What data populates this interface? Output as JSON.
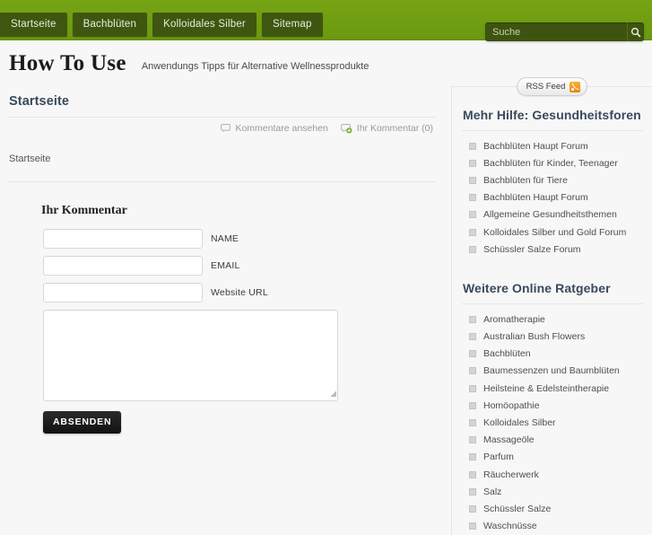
{
  "nav": {
    "items": [
      {
        "label": "Startseite"
      },
      {
        "label": "Bachblüten"
      },
      {
        "label": "Kolloidales Silber"
      },
      {
        "label": "Sitemap"
      }
    ]
  },
  "search": {
    "placeholder": "Suche",
    "value": "",
    "icon": "search-icon"
  },
  "masthead": {
    "title": "How To Use",
    "tagline": "Anwendungs Tipps für Alternative Wellnessprodukte"
  },
  "post": {
    "title": "Startseite",
    "body": "Startseite",
    "meta": {
      "view_comments": "Kommentare ansehen",
      "add_comment": "Ihr Kommentar (0)"
    }
  },
  "comment_form": {
    "heading": "Ihr Kommentar",
    "fields": [
      {
        "label": "NAME",
        "value": "",
        "placeholder": ""
      },
      {
        "label": "EMAIL",
        "value": "",
        "placeholder": ""
      },
      {
        "label": "Website URL",
        "value": "",
        "placeholder": ""
      }
    ],
    "textarea": {
      "value": "",
      "placeholder": ""
    },
    "submit_label": "ABSENDEN"
  },
  "sidebar": {
    "rss": {
      "label": "RSS Feed",
      "icon": "rss-icon"
    },
    "widgets": [
      {
        "title": "Mehr Hilfe: Gesundheitsforen",
        "items": [
          "Bachblüten Haupt Forum",
          "Bachblüten für Kinder, Teenager",
          "Bachblüten für Tiere",
          "Bachblüten Haupt Forum",
          "Allgemeine Gesundheitsthemen",
          "Kolloidales Silber und Gold Forum",
          "Schüssler Salze Forum"
        ]
      },
      {
        "title": "Weitere Online Ratgeber",
        "items": [
          "Aromatherapie",
          "Australian Bush Flowers",
          "Bachblüten",
          "Baumessenzen und Baumblüten",
          "Heilsteine & Edelsteintherapie",
          "Homöopathie",
          "Kolloidales Silber",
          "Massageöle",
          "Parfum",
          "Räucherwerk",
          "Salz",
          "Schüssler Salze",
          "Waschnüsse"
        ]
      }
    ]
  },
  "colors": {
    "nav_green": "#6f9c12",
    "tab_olive": "#3f5610",
    "heading_blue": "#3a4a5c",
    "rss_orange": "#e8850c",
    "submit_dark": "#1d1d1d"
  }
}
